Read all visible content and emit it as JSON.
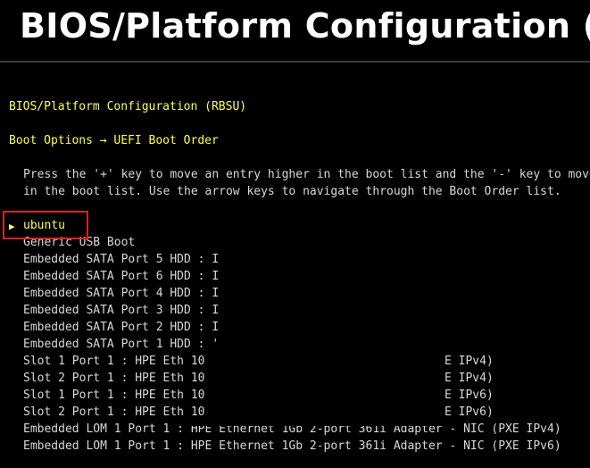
{
  "header": {
    "title": "BIOS/Platform Configuration (RBSU)"
  },
  "screen": {
    "menu_title": "BIOS/Platform Configuration (RBSU)",
    "breadcrumb": "Boot Options → UEFI Boot Order",
    "help_line_1": "Press the '+' key to move an entry higher in the boot list and the '-' key to move an entry lower",
    "help_line_2": "in the boot list. Use the arrow keys to navigate through the Boot Order list.",
    "cursor_glyph": "▶",
    "entries": [
      "ubuntu",
      "Generic USB Boot",
      "Embedded SATA Port 5 HDD : I",
      "Embedded SATA Port 6 HDD : I",
      "Embedded SATA Port 4 HDD : I",
      "Embedded SATA Port 3 HDD : I",
      "Embedded SATA Port 2 HDD : I",
      "Embedded SATA Port 1 HDD : '",
      "Slot 1 Port 1 : HPE Eth 10",
      "Slot 2 Port 1 : HPE Eth 10",
      "Slot 1 Port 1 : HPE Eth 10",
      "Slot 2 Port 1 : HPE Eth 10",
      "Embedded LOM 1 Port 1 : HPE Ethernet 1Gb 2-port 361i Adapter - NIC (PXE IPv4)",
      "Embedded LOM 1 Port 1 : HPE Ethernet 1Gb 2-port 361i Adapter - NIC (PXE IPv6)"
    ],
    "entry_suffixes": [
      "E IPv4)",
      "E IPv4)",
      "E IPv6)",
      "E IPv6)"
    ]
  },
  "colors": {
    "selected_text": "#ffff55",
    "normal_text": "#d8d8d8",
    "highlight_box": "#e02020",
    "background": "#000000"
  }
}
